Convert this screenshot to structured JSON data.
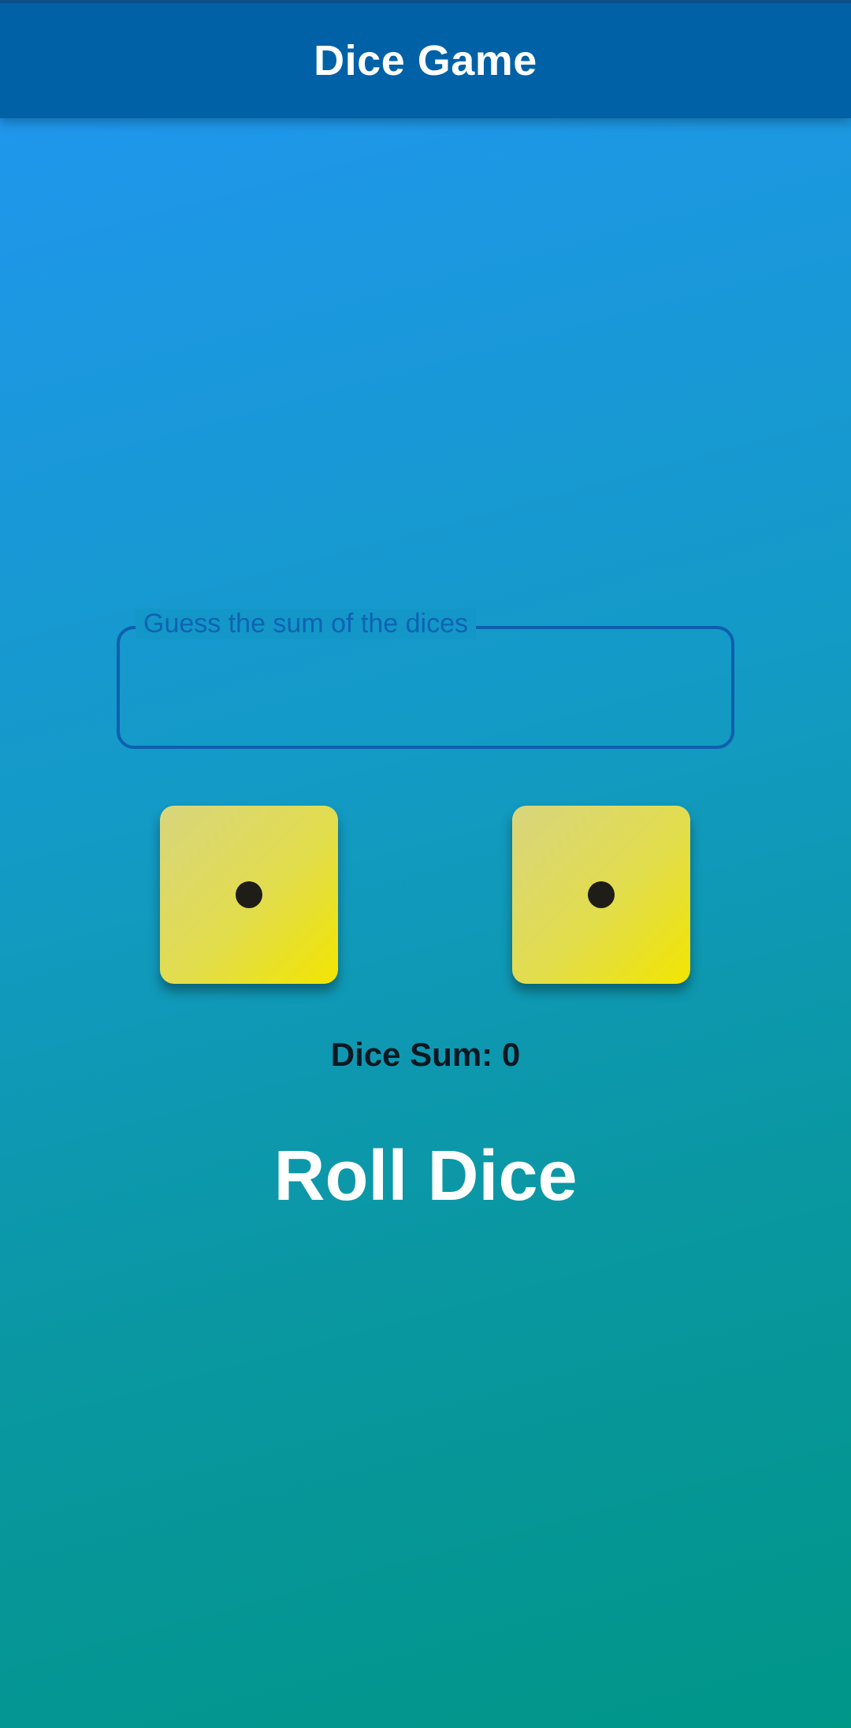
{
  "app_bar": {
    "title": "Dice Game"
  },
  "guess": {
    "label": "Guess the sum of the dices",
    "value": ""
  },
  "dice": [
    {
      "value": 1
    },
    {
      "value": 1
    }
  ],
  "result": {
    "sum_text": "Dice Sum: 0"
  },
  "actions": {
    "roll_label": "Roll Dice"
  },
  "colors": {
    "app_bar": "#0061a6",
    "background_top": "#2196f3",
    "background_bottom": "#009688",
    "die_face": "#e2dd4c",
    "pip": "#1e1d18",
    "field_border": "#0d5fae"
  }
}
